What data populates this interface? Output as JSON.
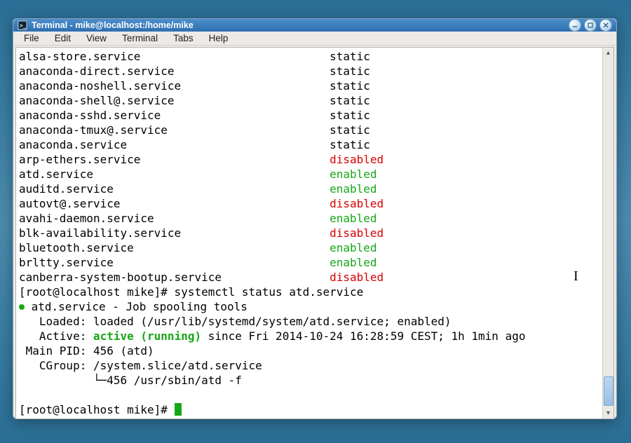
{
  "window": {
    "title": "Terminal - mike@localhost:/home/mike"
  },
  "menu": {
    "items": [
      "File",
      "Edit",
      "View",
      "Terminal",
      "Tabs",
      "Help"
    ]
  },
  "services": [
    {
      "name": "alsa-store.service",
      "status": "static",
      "color": "plain"
    },
    {
      "name": "anaconda-direct.service",
      "status": "static",
      "color": "plain"
    },
    {
      "name": "anaconda-noshell.service",
      "status": "static",
      "color": "plain"
    },
    {
      "name": "anaconda-shell@.service",
      "status": "static",
      "color": "plain"
    },
    {
      "name": "anaconda-sshd.service",
      "status": "static",
      "color": "plain"
    },
    {
      "name": "anaconda-tmux@.service",
      "status": "static",
      "color": "plain"
    },
    {
      "name": "anaconda.service",
      "status": "static",
      "color": "plain"
    },
    {
      "name": "arp-ethers.service",
      "status": "disabled",
      "color": "red"
    },
    {
      "name": "atd.service",
      "status": "enabled",
      "color": "green"
    },
    {
      "name": "auditd.service",
      "status": "enabled",
      "color": "green"
    },
    {
      "name": "autovt@.service",
      "status": "disabled",
      "color": "red"
    },
    {
      "name": "avahi-daemon.service",
      "status": "enabled",
      "color": "green"
    },
    {
      "name": "blk-availability.service",
      "status": "disabled",
      "color": "red"
    },
    {
      "name": "bluetooth.service",
      "status": "enabled",
      "color": "green"
    },
    {
      "name": "brltty.service",
      "status": "enabled",
      "color": "green"
    },
    {
      "name": "canberra-system-bootup.service",
      "status": "disabled",
      "color": "red"
    }
  ],
  "status_cmd": {
    "prompt": "[root@localhost mike]# ",
    "command": "systemctl status atd.service",
    "bullet_line": " atd.service - Job spooling tools",
    "loaded": "   Loaded: loaded (/usr/lib/systemd/system/atd.service; enabled)",
    "active_prefix": "   Active: ",
    "active_state": "active (running)",
    "active_suffix": " since Fri 2014-10-24 16:28:59 CEST; 1h 1min ago",
    "main_pid": " Main PID: 456 (atd)",
    "cgroup": "   CGroup: /system.slice/atd.service",
    "cgroup_child": "           └─456 /usr/sbin/atd -f"
  },
  "prompt2": "[root@localhost mike]# "
}
